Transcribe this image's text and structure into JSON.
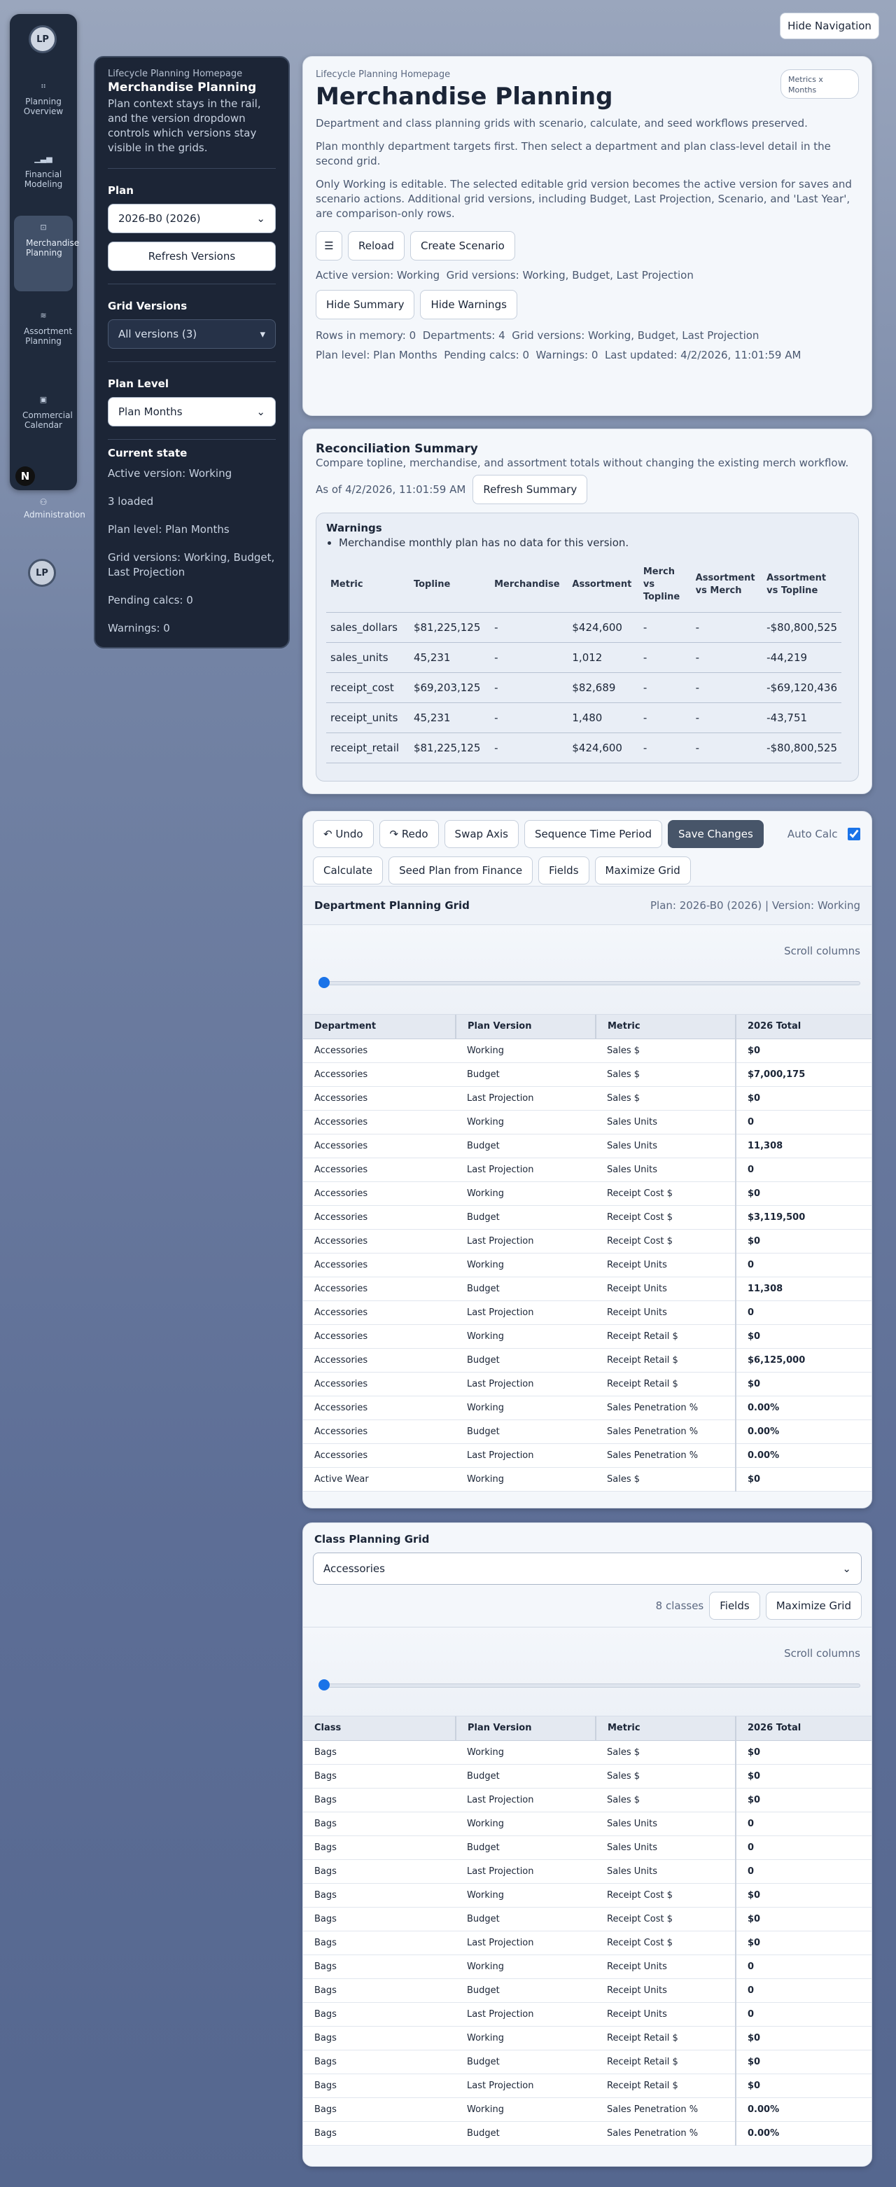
{
  "nav": {
    "avatar": "LP",
    "items": [
      {
        "label": "Planning Overview",
        "icon": "grid-icon"
      },
      {
        "label": "Financial Modeling",
        "icon": "bar-chart-icon"
      },
      {
        "label": "Merchandise Planning",
        "icon": "bag-icon"
      },
      {
        "label": "Assortment Planning",
        "icon": "layers-icon"
      },
      {
        "label": "Commercial Calendar",
        "icon": "calendar-icon"
      }
    ],
    "admin": "Administration",
    "bottom_avatar": "LP",
    "logo": "N",
    "hide_label": "Hide Navigation"
  },
  "rail": {
    "kicker": "Lifecycle Planning Homepage",
    "title": "Merchandise Planning",
    "desc": "Plan context stays in the rail, and the version dropdown controls which versions stay visible in the grids.",
    "plan_heading": "Plan",
    "plan_value": "2026-B0 (2026)",
    "refresh_label": "Refresh Versions",
    "grid_versions_heading": "Grid Versions",
    "grid_versions_value": "All versions (3)",
    "plan_level_heading": "Plan Level",
    "plan_level_value": "Plan Months",
    "state_heading": "Current state",
    "state": [
      "Active version: Working",
      "3 loaded",
      "Plan level: Plan Months",
      "Grid versions: Working, Budget, Last Projection",
      "Pending calcs: 0",
      "Warnings: 0"
    ]
  },
  "top": {
    "kicker": "Lifecycle Planning Homepage",
    "title": "Merchandise Planning",
    "chip": "Metrics x Months",
    "desc1": "Department and class planning grids with scenario, calculate, and seed workflows preserved.",
    "desc2": "Plan monthly department targets first. Then select a department and plan class-level detail in the second grid.",
    "desc3": "Only Working is editable. The selected editable grid version becomes the active version for saves and scenario actions. Additional grid versions, including Budget, Last Projection, Scenario, and 'Last Year', are comparison-only rows.",
    "menu_icon": "menu-icon",
    "reload": "Reload",
    "create_scenario": "Create Scenario",
    "active_version": "Active version: Working",
    "grid_versions": "Grid versions: Working, Budget, Last Projection",
    "hide_summary": "Hide Summary",
    "hide_warnings": "Hide Warnings",
    "rows": "Rows in memory: 0",
    "departments": "Departments: 4",
    "grid_versions2": "Grid versions: Working, Budget, Last Projection",
    "plan_level": "Plan level: Plan Months",
    "pending": "Pending calcs: 0",
    "warnings": "Warnings: 0",
    "updated": "Last updated: 4/2/2026, 11:01:59 AM"
  },
  "recon": {
    "title": "Reconciliation Summary",
    "desc": "Compare topline, merchandise, and assortment totals without changing the existing merch workflow.",
    "as_of": "As of 4/2/2026, 11:01:59 AM",
    "refresh": "Refresh Summary",
    "warnings_title": "Warnings",
    "warning": "Merchandise monthly plan has no data for this version.",
    "headers": [
      "Metric",
      "Topline",
      "Merchandise",
      "Assortment",
      "Merch vs Topline",
      "Assortment vs Merch",
      "Assortment vs Topline"
    ],
    "rows": [
      [
        "sales_dollars",
        "$81,225,125",
        "-",
        "$424,600",
        "-",
        "-",
        "-$80,800,525"
      ],
      [
        "sales_units",
        "45,231",
        "-",
        "1,012",
        "-",
        "-",
        "-44,219"
      ],
      [
        "receipt_cost",
        "$69,203,125",
        "-",
        "$82,689",
        "-",
        "-",
        "-$69,120,436"
      ],
      [
        "receipt_units",
        "45,231",
        "-",
        "1,480",
        "-",
        "-",
        "-43,751"
      ],
      [
        "receipt_retail",
        "$81,225,125",
        "-",
        "$424,600",
        "-",
        "-",
        "-$80,800,525"
      ]
    ]
  },
  "toolbar": {
    "undo": "↶ Undo",
    "redo": "↷ Redo",
    "swap": "Swap Axis",
    "sequence": "Sequence Time Period",
    "save": "Save Changes",
    "autocalc": "Auto Calc",
    "calculate": "Calculate",
    "seed": "Seed Plan from Finance",
    "fields": "Fields",
    "maximize": "Maximize Grid"
  },
  "dept_grid": {
    "title": "Department Planning Grid",
    "meta": "Plan: 2026-B0 (2026) | Version: Working",
    "scroll_label": "Scroll columns",
    "scroll_position": 0.0,
    "headers": [
      "Department",
      "Plan Version",
      "Metric",
      "2026 Total"
    ],
    "rows": [
      [
        "Accessories",
        "Working",
        "Sales $",
        "$0"
      ],
      [
        "Accessories",
        "Budget",
        "Sales $",
        "$7,000,175"
      ],
      [
        "Accessories",
        "Last Projection",
        "Sales $",
        "$0"
      ],
      [
        "Accessories",
        "Working",
        "Sales Units",
        "0"
      ],
      [
        "Accessories",
        "Budget",
        "Sales Units",
        "11,308"
      ],
      [
        "Accessories",
        "Last Projection",
        "Sales Units",
        "0"
      ],
      [
        "Accessories",
        "Working",
        "Receipt Cost $",
        "$0"
      ],
      [
        "Accessories",
        "Budget",
        "Receipt Cost $",
        "$3,119,500"
      ],
      [
        "Accessories",
        "Last Projection",
        "Receipt Cost $",
        "$0"
      ],
      [
        "Accessories",
        "Working",
        "Receipt Units",
        "0"
      ],
      [
        "Accessories",
        "Budget",
        "Receipt Units",
        "11,308"
      ],
      [
        "Accessories",
        "Last Projection",
        "Receipt Units",
        "0"
      ],
      [
        "Accessories",
        "Working",
        "Receipt Retail $",
        "$0"
      ],
      [
        "Accessories",
        "Budget",
        "Receipt Retail $",
        "$6,125,000"
      ],
      [
        "Accessories",
        "Last Projection",
        "Receipt Retail $",
        "$0"
      ],
      [
        "Accessories",
        "Working",
        "Sales Penetration %",
        "0.00%"
      ],
      [
        "Accessories",
        "Budget",
        "Sales Penetration %",
        "0.00%"
      ],
      [
        "Accessories",
        "Last Projection",
        "Sales Penetration %",
        "0.00%"
      ],
      [
        "Active Wear",
        "Working",
        "Sales $",
        "$0"
      ]
    ]
  },
  "class_grid": {
    "title": "Class Planning Grid",
    "department": "Accessories",
    "count": "8 classes",
    "fields": "Fields",
    "maximize": "Maximize Grid",
    "scroll_label": "Scroll columns",
    "scroll_position": 0.0,
    "headers": [
      "Class",
      "Plan Version",
      "Metric",
      "2026 Total"
    ],
    "rows": [
      [
        "Bags",
        "Working",
        "Sales $",
        "$0"
      ],
      [
        "Bags",
        "Budget",
        "Sales $",
        "$0"
      ],
      [
        "Bags",
        "Last Projection",
        "Sales $",
        "$0"
      ],
      [
        "Bags",
        "Working",
        "Sales Units",
        "0"
      ],
      [
        "Bags",
        "Budget",
        "Sales Units",
        "0"
      ],
      [
        "Bags",
        "Last Projection",
        "Sales Units",
        "0"
      ],
      [
        "Bags",
        "Working",
        "Receipt Cost $",
        "$0"
      ],
      [
        "Bags",
        "Budget",
        "Receipt Cost $",
        "$0"
      ],
      [
        "Bags",
        "Last Projection",
        "Receipt Cost $",
        "$0"
      ],
      [
        "Bags",
        "Working",
        "Receipt Units",
        "0"
      ],
      [
        "Bags",
        "Budget",
        "Receipt Units",
        "0"
      ],
      [
        "Bags",
        "Last Projection",
        "Receipt Units",
        "0"
      ],
      [
        "Bags",
        "Working",
        "Receipt Retail $",
        "$0"
      ],
      [
        "Bags",
        "Budget",
        "Receipt Retail $",
        "$0"
      ],
      [
        "Bags",
        "Last Projection",
        "Receipt Retail $",
        "$0"
      ],
      [
        "Bags",
        "Working",
        "Sales Penetration %",
        "0.00%"
      ],
      [
        "Bags",
        "Budget",
        "Sales Penetration %",
        "0.00%"
      ]
    ]
  }
}
